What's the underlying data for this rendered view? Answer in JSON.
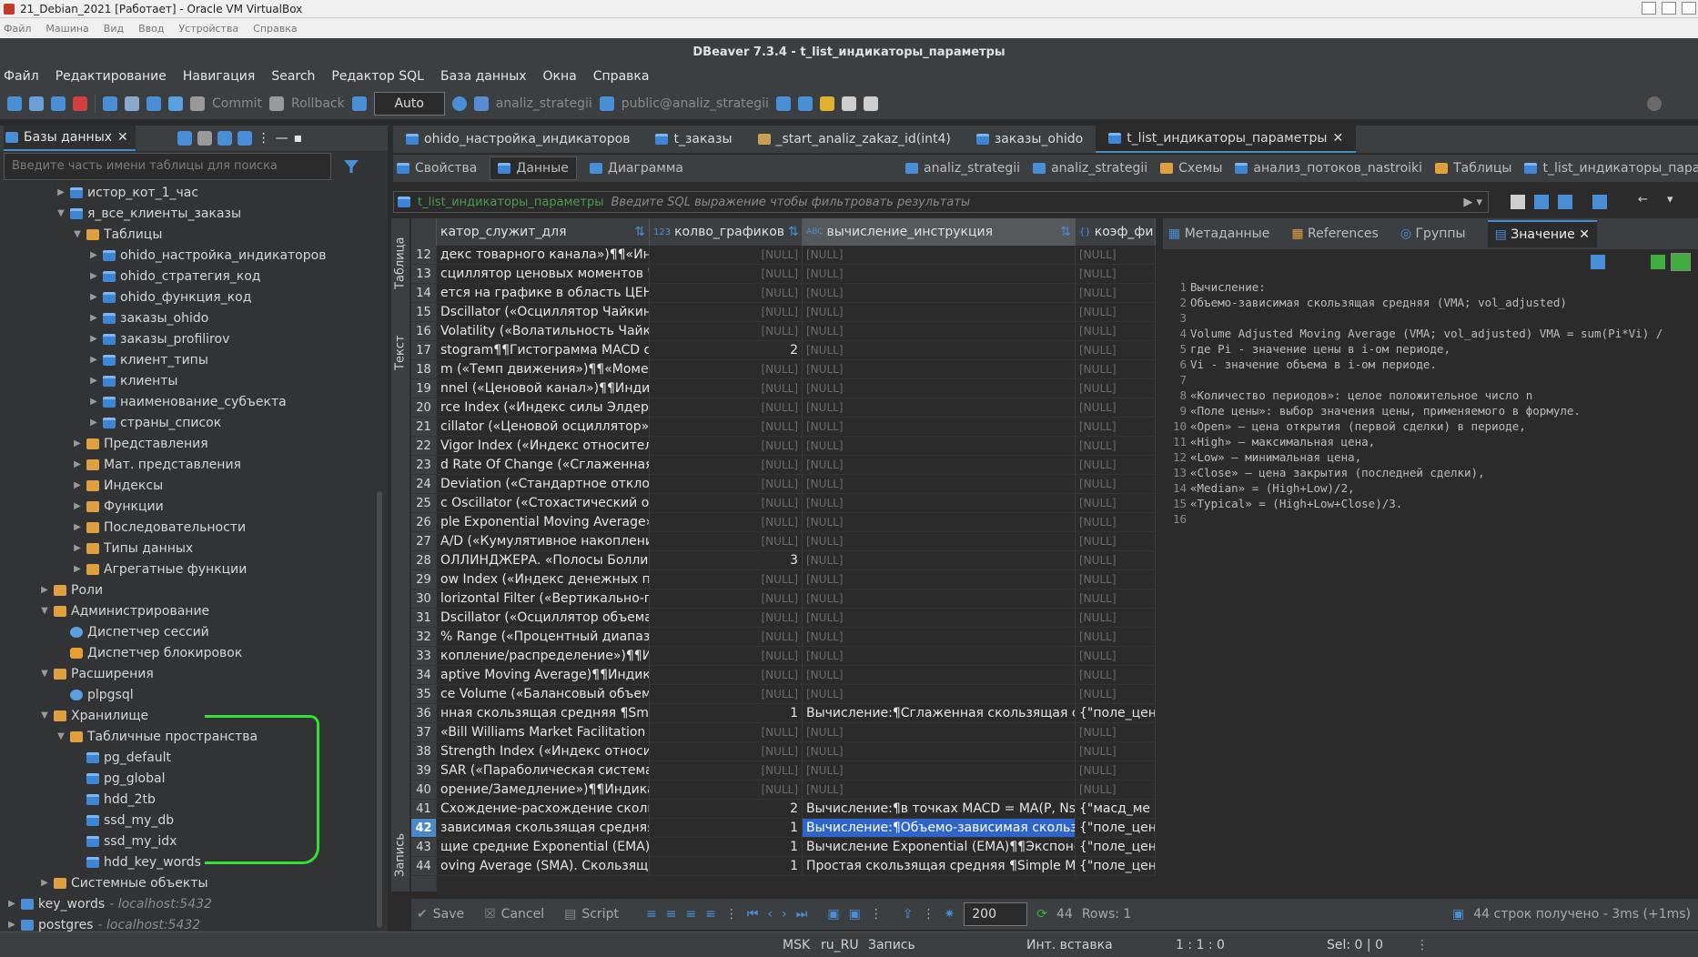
{
  "vbox": {
    "title": "21_Debian_2021 [Работает] - Oracle VM VirtualBox",
    "menu": [
      "Файл",
      "Машина",
      "Вид",
      "Ввод",
      "Устройства",
      "Справка"
    ]
  },
  "app": {
    "title": "DBeaver 7.3.4 - t_list_индикаторы_параметры"
  },
  "menu": [
    "Файл",
    "Редактирование",
    "Навигация",
    "Search",
    "Редактор SQL",
    "База данных",
    "Окна",
    "Справка"
  ],
  "toolbar": {
    "commit": "Commit",
    "rollback": "Rollback",
    "mode": "Auto",
    "datasource": "analiz_strategii",
    "schema": "public@analiz_strategii"
  },
  "left": {
    "tab": "Базы данных",
    "search_placeholder": "Введите часть имени таблицы для поиска",
    "tree": [
      {
        "label": "истор_кот_1_час",
        "lvl": 3,
        "arrow": "▶",
        "icon": "tbl"
      },
      {
        "label": "я_все_клиенты_заказы",
        "lvl": 3,
        "arrow": "▼",
        "icon": "tbl"
      },
      {
        "label": "Таблицы",
        "lvl": 4,
        "arrow": "▼",
        "icon": "fold"
      },
      {
        "label": "ohido_настройка_индикаторов",
        "lvl": 5,
        "arrow": "▶",
        "icon": "tbl"
      },
      {
        "label": "ohido_стратегия_код",
        "lvl": 5,
        "arrow": "▶",
        "icon": "tbl"
      },
      {
        "label": "ohido_функция_код",
        "lvl": 5,
        "arrow": "▶",
        "icon": "tbl"
      },
      {
        "label": "заказы_ohido",
        "lvl": 5,
        "arrow": "▶",
        "icon": "tbl"
      },
      {
        "label": "заказы_profilirov",
        "lvl": 5,
        "arrow": "▶",
        "icon": "tbl"
      },
      {
        "label": "клиент_типы",
        "lvl": 5,
        "arrow": "▶",
        "icon": "tbl"
      },
      {
        "label": "клиенты",
        "lvl": 5,
        "arrow": "▶",
        "icon": "tbl"
      },
      {
        "label": "наименование_субъекта",
        "lvl": 5,
        "arrow": "▶",
        "icon": "tbl"
      },
      {
        "label": "страны_список",
        "lvl": 5,
        "arrow": "▶",
        "icon": "tbl"
      },
      {
        "label": "Представления",
        "lvl": 4,
        "arrow": "▶",
        "icon": "fold"
      },
      {
        "label": "Мат. представления",
        "lvl": 4,
        "arrow": "▶",
        "icon": "fold"
      },
      {
        "label": "Индексы",
        "lvl": 4,
        "arrow": "▶",
        "icon": "fold"
      },
      {
        "label": "Функции",
        "lvl": 4,
        "arrow": "▶",
        "icon": "fold"
      },
      {
        "label": "Последовательности",
        "lvl": 4,
        "arrow": "▶",
        "icon": "fold"
      },
      {
        "label": "Типы данных",
        "lvl": 4,
        "arrow": "▶",
        "icon": "fold"
      },
      {
        "label": "Агрегатные функции",
        "lvl": 4,
        "arrow": "▶",
        "icon": "fold"
      },
      {
        "label": "Роли",
        "lvl": 2,
        "arrow": "▶",
        "icon": "fold"
      },
      {
        "label": "Администрирование",
        "lvl": 2,
        "arrow": "▼",
        "icon": "fold"
      },
      {
        "label": "Диспетчер сессий",
        "lvl": 3,
        "arrow": "",
        "icon": "gear"
      },
      {
        "label": "Диспетчер блокировок",
        "lvl": 3,
        "arrow": "",
        "icon": "lock"
      },
      {
        "label": "Расширения",
        "lvl": 2,
        "arrow": "▼",
        "icon": "fold"
      },
      {
        "label": "plpgsql",
        "lvl": 3,
        "arrow": "",
        "icon": "gear"
      },
      {
        "label": "Хранилище",
        "lvl": 2,
        "arrow": "▼",
        "icon": "fold"
      },
      {
        "label": "Табличные пространства",
        "lvl": 3,
        "arrow": "▼",
        "icon": "fold"
      },
      {
        "label": "pg_default",
        "lvl": 4,
        "arrow": "",
        "icon": "tbl"
      },
      {
        "label": "pg_global",
        "lvl": 4,
        "arrow": "",
        "icon": "tbl"
      },
      {
        "label": "hdd_2tb",
        "lvl": 4,
        "arrow": "",
        "icon": "tbl"
      },
      {
        "label": "ssd_my_db",
        "lvl": 4,
        "arrow": "",
        "icon": "tbl"
      },
      {
        "label": "ssd_my_idx",
        "lvl": 4,
        "arrow": "",
        "icon": "tbl"
      },
      {
        "label": "hdd_key_words",
        "lvl": 4,
        "arrow": "",
        "icon": "tbl"
      },
      {
        "label": "Системные объекты",
        "lvl": 2,
        "arrow": "▶",
        "icon": "fold"
      },
      {
        "label": "key_words",
        "sub": " - localhost:5432",
        "lvl": 0,
        "arrow": "▶",
        "icon": "db"
      },
      {
        "label": "postgres",
        "sub": " - localhost:5432",
        "lvl": 0,
        "arrow": "▶",
        "icon": "db"
      }
    ]
  },
  "tabs": [
    "ohido_настройка_индикаторов",
    "t_заказы",
    "_start_analiz_zakaz_id(int4)",
    "заказы_ohido",
    "t_list_индикаторы_параметры"
  ],
  "subtabs": {
    "props": "Свойства",
    "data": "Данные",
    "diagram": "Диаграмма",
    "crumbs": [
      "analiz_strategii",
      "analiz_strategii",
      "Схемы",
      "анализ_потоков_nastroiki",
      "Таблицы",
      "t_list_индикаторы_параме"
    ]
  },
  "filter": {
    "table": "t_list_индикаторы_параметры",
    "placeholder": "Введите SQL выражение чтобы фильтровать результаты"
  },
  "vtabs": {
    "table": "Таблица",
    "text": "Текст",
    "record": "Запись"
  },
  "grid": {
    "headers": [
      "катор_служит_для",
      "колво_графиков",
      "вычисление_инструкция",
      "коэф_фи"
    ],
    "rows": [
      {
        "n": "12",
        "c1": "декс товарного канала»)¶¶«Инде",
        "c2": "[NULL]",
        "c3": "[NULL]",
        "c4": "[NULL]"
      },
      {
        "n": "13",
        "c1": "сциллятор ценовых моментов Ча",
        "c2": "[NULL]",
        "c3": "[NULL]",
        "c4": "[NULL]"
      },
      {
        "n": "14",
        "c1": "ется на графике в область ЦЕНА.",
        "c2": "[NULL]",
        "c3": "[NULL]",
        "c4": "[NULL]"
      },
      {
        "n": "15",
        "c1": "Dscillator («Осциллятор Чайкина»)",
        "c2": "[NULL]",
        "c3": "[NULL]",
        "c4": "[NULL]"
      },
      {
        "n": "16",
        "c1": "Volatility («Волатильность Чайки",
        "c2": "[NULL]",
        "c3": "[NULL]",
        "c4": "[NULL]"
      },
      {
        "n": "17",
        "c1": "stogram¶¶Гистограмма MACD стр",
        "c2": "2",
        "c3": "[NULL]",
        "c4": "[NULL]"
      },
      {
        "n": "18",
        "c1": "m («Темп движения»)¶¶«Момент",
        "c2": "[NULL]",
        "c3": "[NULL]",
        "c4": "[NULL]"
      },
      {
        "n": "19",
        "c1": "nnel («Ценовой канал»)¶¶Индика",
        "c2": "[NULL]",
        "c3": "[NULL]",
        "c4": "[NULL]"
      },
      {
        "n": "20",
        "c1": "rce Index («Индекс силы Элдера»",
        "c2": "[NULL]",
        "c3": "[NULL]",
        "c4": "[NULL]"
      },
      {
        "n": "21",
        "c1": "cillator («Ценовой осциллятор»)¶¶",
        "c2": "[NULL]",
        "c3": "[NULL]",
        "c4": "[NULL]"
      },
      {
        "n": "22",
        "c1": "Vigor Index («Индекс относительн",
        "c2": "[NULL]",
        "c3": "[NULL]",
        "c4": "[NULL]"
      },
      {
        "n": "23",
        "c1": "d Rate Of Change («Сглаженная ск",
        "c2": "[NULL]",
        "c3": "[NULL]",
        "c4": "[NULL]"
      },
      {
        "n": "24",
        "c1": "Deviation («Стандартное отклоне",
        "c2": "[NULL]",
        "c3": "[NULL]",
        "c4": "[NULL]"
      },
      {
        "n": "25",
        "c1": "c Oscillator («Стохастический осц",
        "c2": "[NULL]",
        "c3": "[NULL]",
        "c4": "[NULL]"
      },
      {
        "n": "26",
        "c1": "ple Exponential Moving Average»)¶",
        "c2": "[NULL]",
        "c3": "[NULL]",
        "c4": "[NULL]"
      },
      {
        "n": "27",
        "c1": "A/D («Кумулятивное накопление",
        "c2": "[NULL]",
        "c3": "[NULL]",
        "c4": "[NULL]"
      },
      {
        "n": "28",
        "c1": "ОЛЛИНДЖЕРА. «Полосы Боллинд",
        "c2": "3",
        "c3": "[NULL]",
        "c4": "[NULL]"
      },
      {
        "n": "29",
        "c1": "ow Index («Индекс денежных пот",
        "c2": "[NULL]",
        "c3": "[NULL]",
        "c4": "[NULL]"
      },
      {
        "n": "30",
        "c1": "lorizontal Filter («Вертикально-гор",
        "c2": "[NULL]",
        "c3": "[NULL]",
        "c4": "[NULL]"
      },
      {
        "n": "31",
        "c1": "Dscillator («Осциллятор объема»)¶",
        "c2": "[NULL]",
        "c3": "[NULL]",
        "c4": "[NULL]"
      },
      {
        "n": "32",
        "c1": "% Range («Процентный диапазо",
        "c2": "[NULL]",
        "c3": "[NULL]",
        "c4": "[NULL]"
      },
      {
        "n": "33",
        "c1": "копление/распределение»)¶¶Инд",
        "c2": "[NULL]",
        "c3": "[NULL]",
        "c4": "[NULL]"
      },
      {
        "n": "34",
        "c1": "aptive Moving Average)¶¶Индикат",
        "c2": "[NULL]",
        "c3": "[NULL]",
        "c4": "[NULL]"
      },
      {
        "n": "35",
        "c1": "ce Volume («Балансовый объем»)¶",
        "c2": "[NULL]",
        "c3": "[NULL]",
        "c4": "[NULL]"
      },
      {
        "n": "36",
        "c1": "нная скользящая средняя ¶Smooth",
        "c2": "1",
        "c3": "Вычисление:¶Сглаженная скользящая ср",
        "c4": "{\"поле_цен"
      },
      {
        "n": "37",
        "c1": "«Bill Williams Market Facilitation Inc",
        "c2": "[NULL]",
        "c3": "[NULL]",
        "c4": "[NULL]"
      },
      {
        "n": "38",
        "c1": "Strength Index («Индекс относител",
        "c2": "[NULL]",
        "c3": "[NULL]",
        "c4": "[NULL]"
      },
      {
        "n": "39",
        "c1": "SAR («Параболическая система»)",
        "c2": "[NULL]",
        "c3": "[NULL]",
        "c4": "[NULL]"
      },
      {
        "n": "40",
        "c1": "орение/Замедление»)¶¶Индикат",
        "c2": "[NULL]",
        "c3": "[NULL]",
        "c4": "[NULL]"
      },
      {
        "n": "41",
        "c1": "Схождение-расхождение скользя",
        "c2": "2",
        "c3": "Вычисление:¶в точках MACD = MA(P, Nshc",
        "c4": "{\"масд_ме"
      },
      {
        "n": "42",
        "c1": "зависимая скользящая средняя (V",
        "c2": "1",
        "c3": "Вычисление:¶Объемо-зависимая скользя",
        "c4": "{\"поле_цен",
        "cur": true
      },
      {
        "n": "43",
        "c1": "щие средние Exponential (EMA):¶¶",
        "c2": "1",
        "c3": "Вычисление Exponential (EMA)¶¶Экспонен",
        "c4": "{\"поле_цен"
      },
      {
        "n": "44",
        "c1": "oving Average (SMA). Скользящие",
        "c2": "1",
        "c3": "Простая скользящая средняя ¶Simple Mov",
        "c4": "{\"поле_цен"
      }
    ]
  },
  "rpanel": {
    "tabs": [
      "Метаданные",
      "References",
      "Группы",
      "Значение"
    ],
    "lines": [
      "Вычисление:",
      "Объемо-зависимая скользящая средняя (VMA; vol_adjusted)",
      "",
      "Volume Adjusted Moving Average (VMA; vol_adjusted) VMA = sum(Pi*Vi) /",
      "где Pi - значение цены в i-ом периоде,",
      "Vi - значение объема в i-ом периоде.",
      "",
      "«Количество периодов»: целое положительное число n",
      "«Поле цены»: выбор значения цены, применяемого в формуле.",
      "«Open» – цена открытия (первой сделки) в периоде,",
      "«High» – максимальная цена,",
      "«Low» – минимальная цена,",
      "«Close» – цена закрытия (последней сделки),",
      "«Median» = (High+Low)/2,",
      "«Typical» = (High+Low+Close)/3.",
      ""
    ]
  },
  "bottom": {
    "save": "Save",
    "cancel": "Cancel",
    "script": "Script",
    "limit": "200",
    "count": "44",
    "rows": "Rows: 1",
    "fetched": "44 строк получено - 3ms (+1ms)"
  },
  "status": {
    "tz": "MSK",
    "locale": "ru_RU",
    "mode": "Запись",
    "insert": "Инт. вставка",
    "pos": "1 : 1 : 0",
    "sel": "Sel: 0 | 0"
  }
}
